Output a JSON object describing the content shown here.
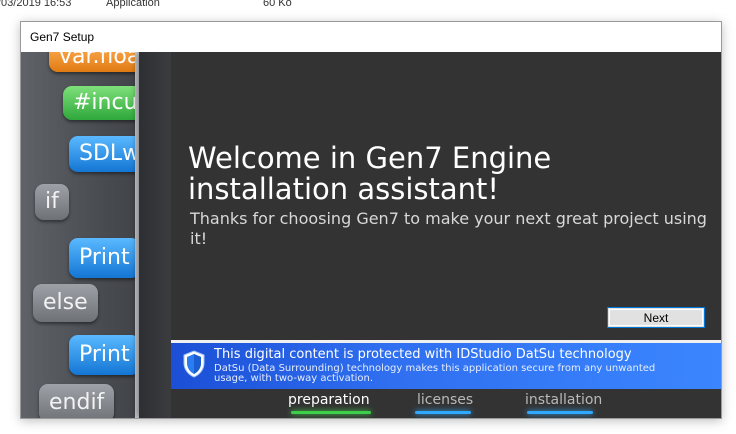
{
  "background_row": {
    "date": "/03/2019 16:53",
    "type": "Application",
    "size": "60 Ko"
  },
  "window": {
    "title": "Gen7 Setup"
  },
  "art": {
    "chips": [
      "var.floa",
      "#incude",
      "SDLwrite",
      "if",
      "Print",
      "else",
      "Print",
      "endif"
    ]
  },
  "content": {
    "heading": "Welcome in Gen7 Engine installation assistant!",
    "subheading": "Thanks for choosing Gen7 to make your next great project using it!",
    "next_label": "Next"
  },
  "banner": {
    "icon": "shield-icon",
    "title": "This digital content is protected with IDStudio DatSu technology",
    "text": "DatSu (Data Surrounding) technology makes this application secure from any unwanted usage, with two-way activation."
  },
  "steps": {
    "items": [
      "preparation",
      "licenses",
      "installation"
    ],
    "active": "preparation"
  },
  "colors": {
    "content_bg": "#333333",
    "banner_blue": "#2f6ff0",
    "step_glow_green": "#3ecf4a",
    "step_glow_blue": "#2fa8ff"
  }
}
